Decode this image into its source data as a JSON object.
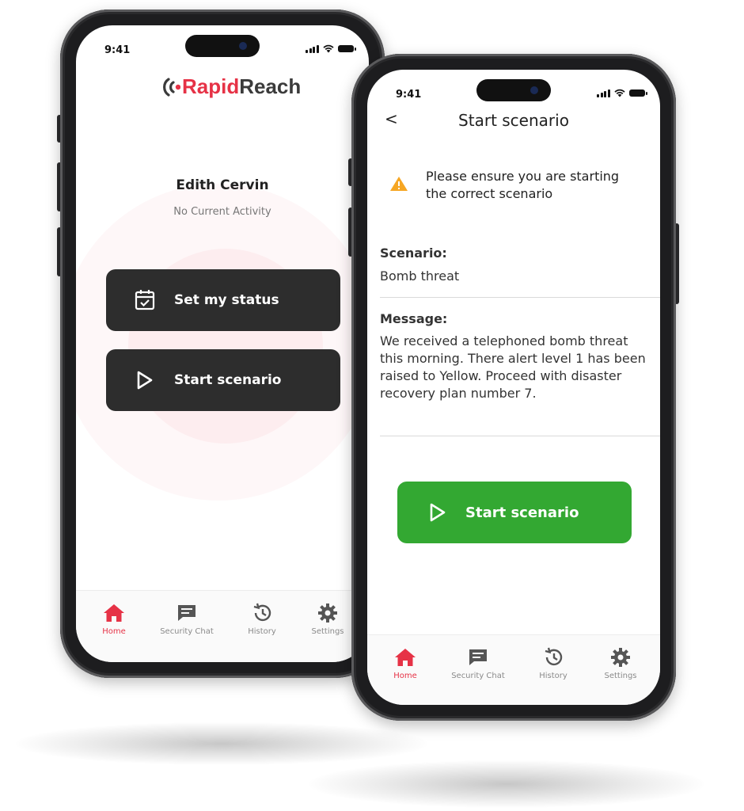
{
  "status_bar": {
    "time": "9:41"
  },
  "brand": {
    "logo_part1": "Rapid",
    "logo_part2": "Reach",
    "accent": "#e63246"
  },
  "home_screen": {
    "user_name": "Edith Cervin",
    "activity": "No Current Activity",
    "set_status_label": "Set my status",
    "start_scenario_label": "Start scenario"
  },
  "scenario_screen": {
    "title": "Start scenario",
    "back_glyph": "<",
    "warning": "Please ensure you are starting the correct scenario",
    "scenario_label": "Scenario:",
    "scenario_value": "Bomb threat",
    "message_label": "Message:",
    "message_value": "We received a telephoned bomb threat this morning. There alert level 1 has been raised to Yellow. Proceed with disaster recovery plan number 7.",
    "start_button_label": "Start scenario",
    "button_color": "#33a832"
  },
  "tabs": [
    {
      "label": "Home",
      "icon": "home-icon",
      "active": true
    },
    {
      "label": "Security Chat",
      "icon": "chat-icon",
      "active": false
    },
    {
      "label": "History",
      "icon": "history-icon",
      "active": false
    },
    {
      "label": "Settings",
      "icon": "gear-icon",
      "active": false
    }
  ]
}
